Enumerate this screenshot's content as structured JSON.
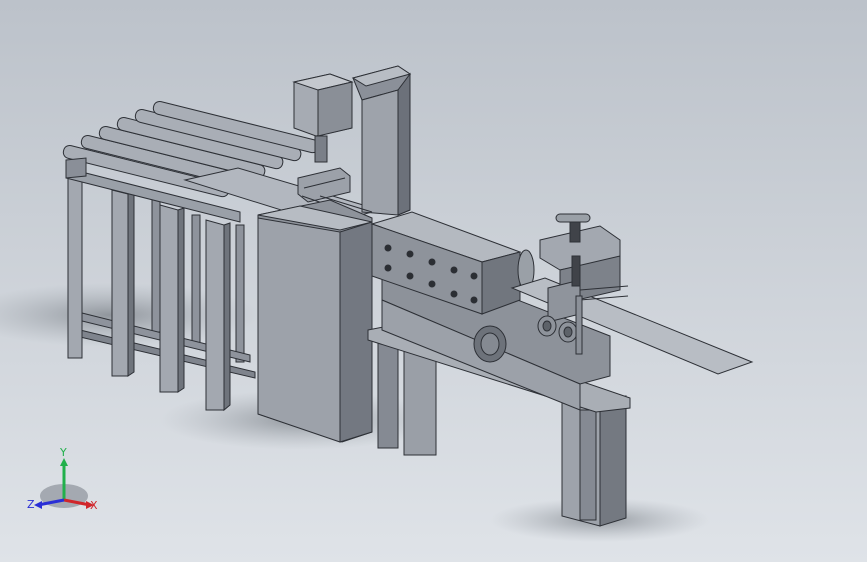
{
  "viewport": {
    "background_top": "#bcc2ca",
    "background_bottom": "#dfe3e8",
    "model": "sheet-metal-processing-line"
  },
  "triad": {
    "labels": {
      "x": "X",
      "y": "Y",
      "z": "Z"
    },
    "colors": {
      "x": "#d0262b",
      "y": "#21b04b",
      "z": "#2a2fd6"
    }
  }
}
